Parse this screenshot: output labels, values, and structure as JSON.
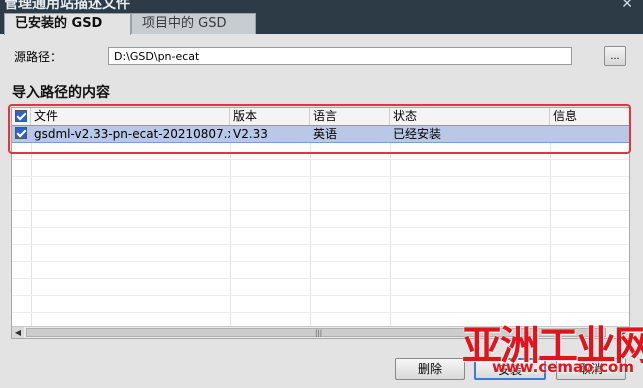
{
  "window": {
    "title": "管理通用站描述文件",
    "close_glyph": "✕"
  },
  "tabs": [
    {
      "label": "已安装的 GSD",
      "active": true
    },
    {
      "label": "项目中的 GSD",
      "active": false
    }
  ],
  "source": {
    "label": "源路径：",
    "value": "D:\\GSD\\pn-ecat",
    "browse_label": "..."
  },
  "section_title": "导入路径的内容",
  "table": {
    "headers": [
      "文件",
      "版本",
      "语言",
      "状态",
      "信息"
    ],
    "header_checked": true,
    "rows": [
      {
        "checked": true,
        "file": "gsdml-v2.33-pn-ecat-20210807.x...",
        "version": "V2.33",
        "language": "英语",
        "status": "已经安装",
        "info": ""
      }
    ]
  },
  "scrollbar": {
    "left_arrow": "◀",
    "right_arrow": "▶",
    "grip": "|||"
  },
  "buttons": {
    "delete": "删除",
    "install": "安装",
    "cancel": "取消"
  },
  "watermark": {
    "text": "亚洲工业网",
    "url": "www.cemao.com"
  },
  "colors": {
    "selection": "#b9c8e6",
    "highlight_box": "#e8323c",
    "watermark": "#e4121b",
    "primary_border": "#3b7ad9"
  }
}
